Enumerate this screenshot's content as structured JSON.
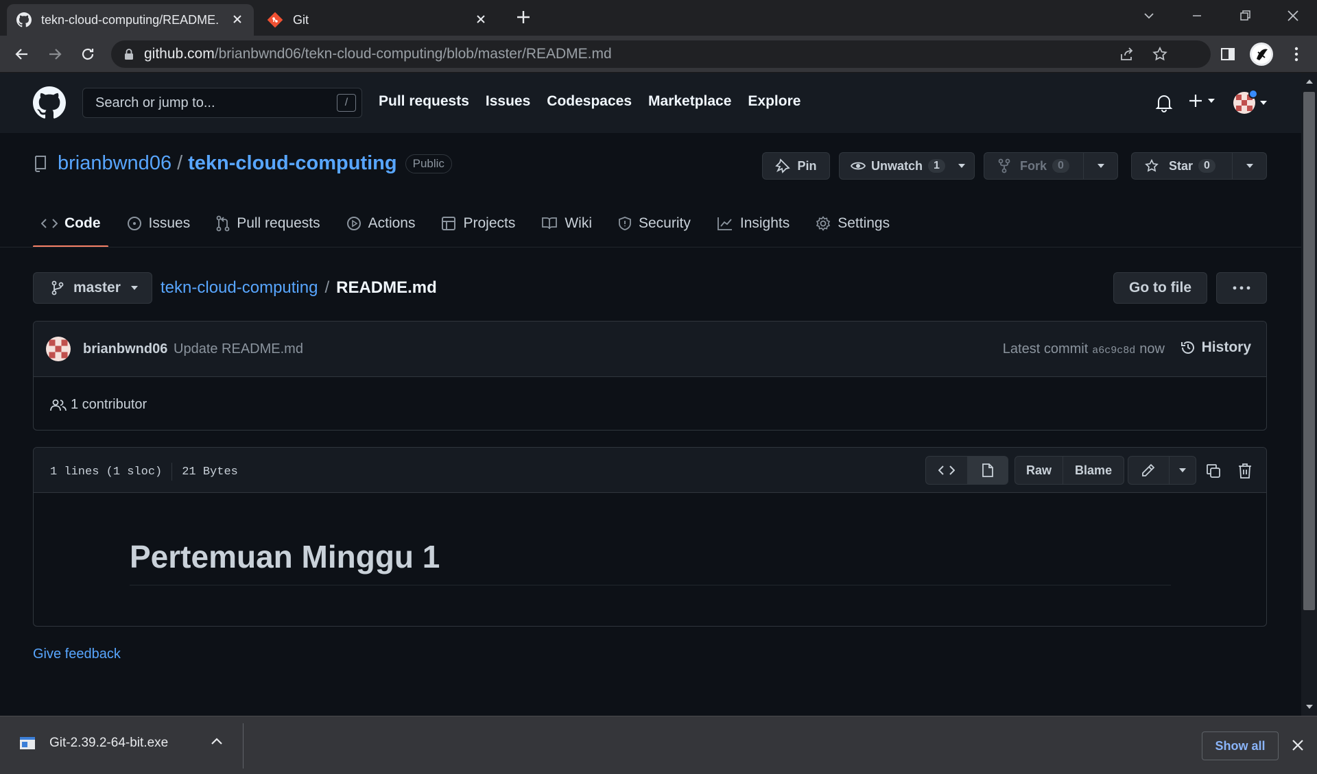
{
  "browser": {
    "tabs": [
      {
        "title": "tekn-cloud-computing/README.md",
        "icon": "github-favicon",
        "active": true
      },
      {
        "title": "Git",
        "icon": "git-favicon",
        "active": false
      }
    ],
    "url_host": "github.com",
    "url_path": "/brianbwnd06/tekn-cloud-computing/blob/master/README.md"
  },
  "gh_header": {
    "search_placeholder": "Search or jump to...",
    "search_key": "/",
    "nav": [
      "Pull requests",
      "Issues",
      "Codespaces",
      "Marketplace",
      "Explore"
    ]
  },
  "repo": {
    "owner": "brianbwnd06",
    "separator": "/",
    "name": "tekn-cloud-computing",
    "visibility": "Public",
    "pin_label": "Pin",
    "unwatch_label": "Unwatch",
    "watch_count": "1",
    "fork_label": "Fork",
    "fork_count": "0",
    "star_label": "Star",
    "star_count": "0",
    "tabs": [
      "Code",
      "Issues",
      "Pull requests",
      "Actions",
      "Projects",
      "Wiki",
      "Security",
      "Insights",
      "Settings"
    ]
  },
  "file": {
    "branch": "master",
    "repo_link": "tekn-cloud-computing",
    "separator": "/",
    "filename": "README.md",
    "goto_label": "Go to file",
    "more_label": "···"
  },
  "commit": {
    "author": "brianbwnd06",
    "message": "Update README.md",
    "latest_label": "Latest commit",
    "sha": "a6c9c8d",
    "time": "now",
    "history_label": "History",
    "contributors": "1 contributor"
  },
  "file_view": {
    "lines": "1 lines (1 sloc)",
    "size": "21 Bytes",
    "raw_label": "Raw",
    "blame_label": "Blame",
    "heading": "Pertemuan Minggu 1"
  },
  "feedback_label": "Give feedback",
  "downloads": {
    "filename": "Git-2.39.2-64-bit.exe",
    "show_all": "Show all"
  },
  "colors": {
    "accent_link": "#58a6ff",
    "tab_underline": "#f78166",
    "page_bg": "#0d1117",
    "header_bg": "#161b22"
  }
}
